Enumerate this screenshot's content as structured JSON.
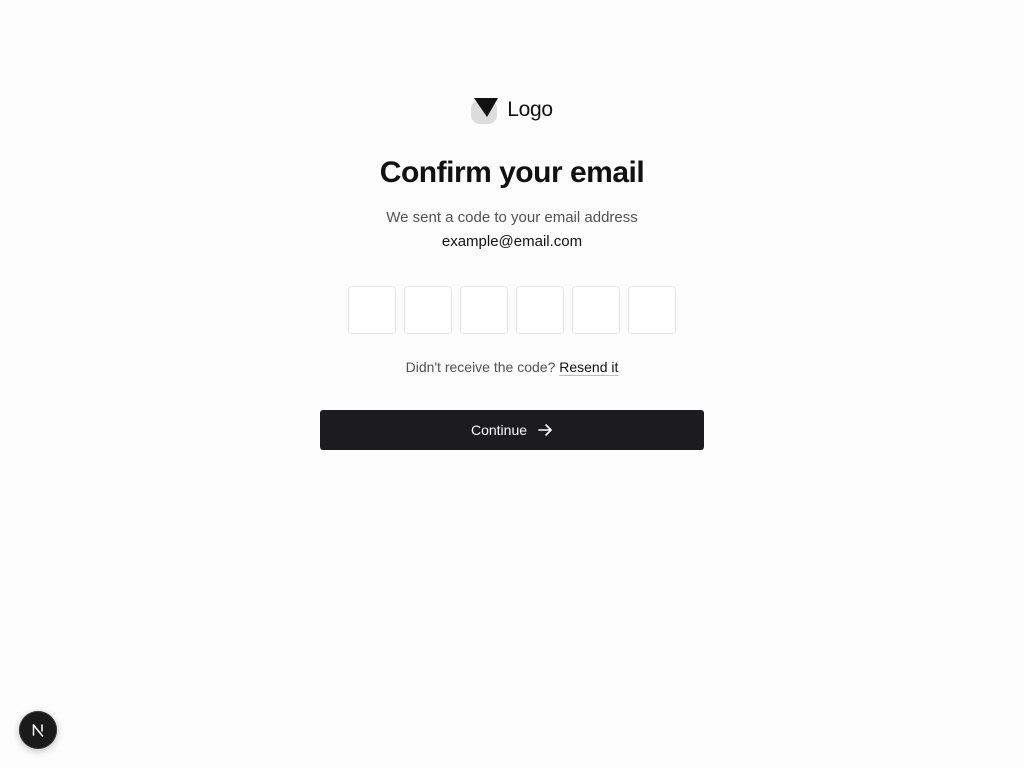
{
  "logo": {
    "text": "Logo",
    "icon": "logo-icon"
  },
  "heading": {
    "title": "Confirm your email",
    "subtitle": "We sent a code to your email address",
    "email": "example@email.com"
  },
  "otp": {
    "digits": [
      "",
      "",
      "",
      "",
      "",
      ""
    ]
  },
  "resend": {
    "prompt": "Didn't receive the code?",
    "link_label": "Resend it"
  },
  "continue_button": {
    "label": "Continue",
    "icon": "arrow-right-icon"
  },
  "dev_badge": {
    "icon": "nextjs-icon",
    "letter": "N"
  },
  "colors": {
    "background": "#fdfdfd",
    "button_bg": "#1c1c1e",
    "button_text": "#ffffff",
    "text_primary": "#111111",
    "text_secondary": "#525252",
    "input_border": "#e5e5e5"
  }
}
